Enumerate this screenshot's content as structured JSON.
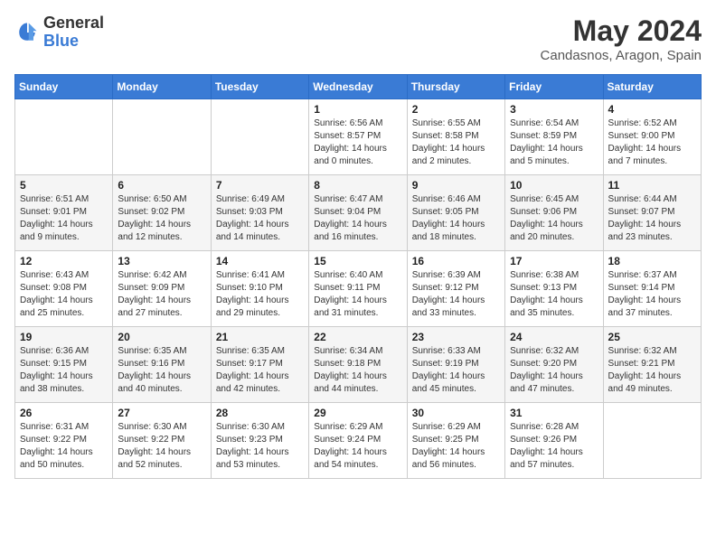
{
  "header": {
    "logo_general": "General",
    "logo_blue": "Blue",
    "title": "May 2024",
    "subtitle": "Candasnos, Aragon, Spain"
  },
  "days_of_week": [
    "Sunday",
    "Monday",
    "Tuesday",
    "Wednesday",
    "Thursday",
    "Friday",
    "Saturday"
  ],
  "weeks": [
    [
      {
        "day": "",
        "content": ""
      },
      {
        "day": "",
        "content": ""
      },
      {
        "day": "",
        "content": ""
      },
      {
        "day": "1",
        "content": "Sunrise: 6:56 AM\nSunset: 8:57 PM\nDaylight: 14 hours\nand 0 minutes."
      },
      {
        "day": "2",
        "content": "Sunrise: 6:55 AM\nSunset: 8:58 PM\nDaylight: 14 hours\nand 2 minutes."
      },
      {
        "day": "3",
        "content": "Sunrise: 6:54 AM\nSunset: 8:59 PM\nDaylight: 14 hours\nand 5 minutes."
      },
      {
        "day": "4",
        "content": "Sunrise: 6:52 AM\nSunset: 9:00 PM\nDaylight: 14 hours\nand 7 minutes."
      }
    ],
    [
      {
        "day": "5",
        "content": "Sunrise: 6:51 AM\nSunset: 9:01 PM\nDaylight: 14 hours\nand 9 minutes."
      },
      {
        "day": "6",
        "content": "Sunrise: 6:50 AM\nSunset: 9:02 PM\nDaylight: 14 hours\nand 12 minutes."
      },
      {
        "day": "7",
        "content": "Sunrise: 6:49 AM\nSunset: 9:03 PM\nDaylight: 14 hours\nand 14 minutes."
      },
      {
        "day": "8",
        "content": "Sunrise: 6:47 AM\nSunset: 9:04 PM\nDaylight: 14 hours\nand 16 minutes."
      },
      {
        "day": "9",
        "content": "Sunrise: 6:46 AM\nSunset: 9:05 PM\nDaylight: 14 hours\nand 18 minutes."
      },
      {
        "day": "10",
        "content": "Sunrise: 6:45 AM\nSunset: 9:06 PM\nDaylight: 14 hours\nand 20 minutes."
      },
      {
        "day": "11",
        "content": "Sunrise: 6:44 AM\nSunset: 9:07 PM\nDaylight: 14 hours\nand 23 minutes."
      }
    ],
    [
      {
        "day": "12",
        "content": "Sunrise: 6:43 AM\nSunset: 9:08 PM\nDaylight: 14 hours\nand 25 minutes."
      },
      {
        "day": "13",
        "content": "Sunrise: 6:42 AM\nSunset: 9:09 PM\nDaylight: 14 hours\nand 27 minutes."
      },
      {
        "day": "14",
        "content": "Sunrise: 6:41 AM\nSunset: 9:10 PM\nDaylight: 14 hours\nand 29 minutes."
      },
      {
        "day": "15",
        "content": "Sunrise: 6:40 AM\nSunset: 9:11 PM\nDaylight: 14 hours\nand 31 minutes."
      },
      {
        "day": "16",
        "content": "Sunrise: 6:39 AM\nSunset: 9:12 PM\nDaylight: 14 hours\nand 33 minutes."
      },
      {
        "day": "17",
        "content": "Sunrise: 6:38 AM\nSunset: 9:13 PM\nDaylight: 14 hours\nand 35 minutes."
      },
      {
        "day": "18",
        "content": "Sunrise: 6:37 AM\nSunset: 9:14 PM\nDaylight: 14 hours\nand 37 minutes."
      }
    ],
    [
      {
        "day": "19",
        "content": "Sunrise: 6:36 AM\nSunset: 9:15 PM\nDaylight: 14 hours\nand 38 minutes."
      },
      {
        "day": "20",
        "content": "Sunrise: 6:35 AM\nSunset: 9:16 PM\nDaylight: 14 hours\nand 40 minutes."
      },
      {
        "day": "21",
        "content": "Sunrise: 6:35 AM\nSunset: 9:17 PM\nDaylight: 14 hours\nand 42 minutes."
      },
      {
        "day": "22",
        "content": "Sunrise: 6:34 AM\nSunset: 9:18 PM\nDaylight: 14 hours\nand 44 minutes."
      },
      {
        "day": "23",
        "content": "Sunrise: 6:33 AM\nSunset: 9:19 PM\nDaylight: 14 hours\nand 45 minutes."
      },
      {
        "day": "24",
        "content": "Sunrise: 6:32 AM\nSunset: 9:20 PM\nDaylight: 14 hours\nand 47 minutes."
      },
      {
        "day": "25",
        "content": "Sunrise: 6:32 AM\nSunset: 9:21 PM\nDaylight: 14 hours\nand 49 minutes."
      }
    ],
    [
      {
        "day": "26",
        "content": "Sunrise: 6:31 AM\nSunset: 9:22 PM\nDaylight: 14 hours\nand 50 minutes."
      },
      {
        "day": "27",
        "content": "Sunrise: 6:30 AM\nSunset: 9:22 PM\nDaylight: 14 hours\nand 52 minutes."
      },
      {
        "day": "28",
        "content": "Sunrise: 6:30 AM\nSunset: 9:23 PM\nDaylight: 14 hours\nand 53 minutes."
      },
      {
        "day": "29",
        "content": "Sunrise: 6:29 AM\nSunset: 9:24 PM\nDaylight: 14 hours\nand 54 minutes."
      },
      {
        "day": "30",
        "content": "Sunrise: 6:29 AM\nSunset: 9:25 PM\nDaylight: 14 hours\nand 56 minutes."
      },
      {
        "day": "31",
        "content": "Sunrise: 6:28 AM\nSunset: 9:26 PM\nDaylight: 14 hours\nand 57 minutes."
      },
      {
        "day": "",
        "content": ""
      }
    ]
  ]
}
